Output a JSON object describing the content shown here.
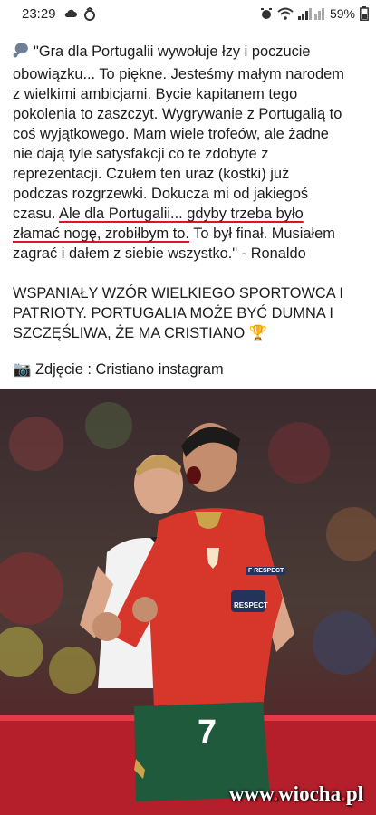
{
  "status_bar": {
    "time": "23:29",
    "battery": "59%",
    "left_icons": [
      "cloud-icon",
      "app-icon"
    ],
    "right_icons": [
      "alarm-icon",
      "wifi-icon",
      "signal-icon",
      "battery-icon"
    ]
  },
  "post": {
    "lines": [
      "\"Gra dla Portugalii wywołuje łzy i poczucie",
      "obowiązku... To piękne. Jesteśmy małym narodem",
      "z wielkimi ambicjami. Bycie kapitanem tego",
      "pokolenia to zaszczyt. Wygrywanie z Portugalią to",
      "coś wyjątkowego. Mam wiele trofeów, ale żadne",
      "nie dają tyle satysfakcji co te zdobyte z",
      "reprezentacji. Czułem ten uraz (kostki) już",
      "podczas rozgrzewki. Dokucza mi od jakiegoś"
    ],
    "line9_prefix": "czasu. ",
    "line9_underlined": "Ale dla Portugalii... gdyby trzeba było",
    "line10_underlined": "złamać nogę, zrobiłbym to.",
    "line10_suffix": " To był finał. Musiałem",
    "line11": "zagrać i dałem z siebie wszystko.\" - Ronaldo",
    "headline_line1": "WSPANIAŁY WZÓR WIELKIEGO SPORTOWCA I",
    "headline_line2": "PATRIOTY. PORTUGALIA MOŻE BYĆ DUMNA I",
    "headline_line3": "SZCZĘŚLIWA, ŻE MA CRISTIANO",
    "headline_emoji": "🏆",
    "photo_credit_emoji": "📷",
    "photo_credit": " Zdjęcie : Cristiano instagram"
  },
  "photo": {
    "jersey_number": "7",
    "sleeve_patch": "F RESPECT",
    "armband": "RESPECT",
    "watermark_prefix": "www",
    "watermark_name": "wiocha",
    "watermark_suffix": "pl"
  },
  "colors": {
    "underline": "#e0112b",
    "portugal_red": "#d7362b",
    "portugal_green": "#1f5a3c"
  }
}
